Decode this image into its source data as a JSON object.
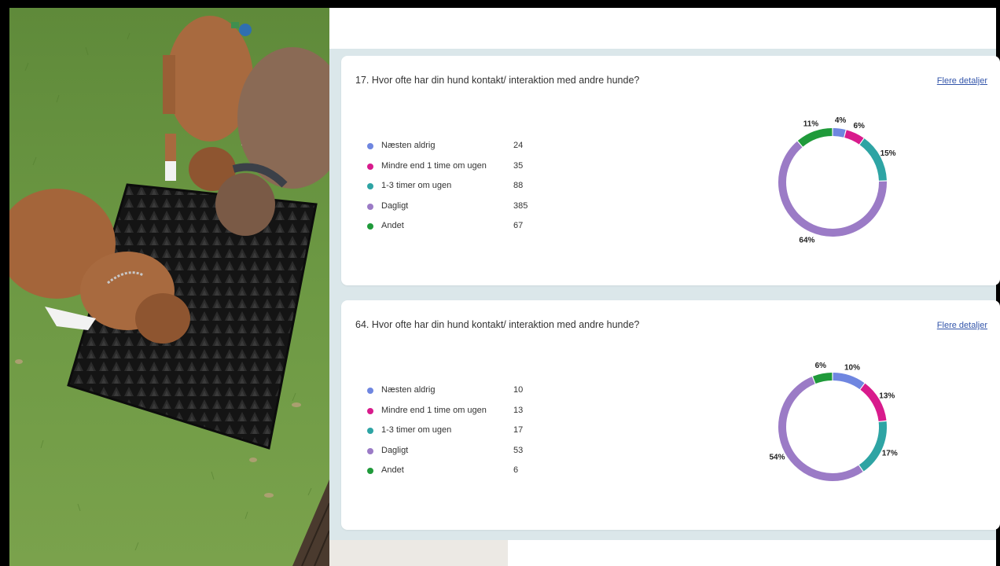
{
  "colors": {
    "naesten_aldrig": "#6f86e0",
    "mindre_end": "#d81b8c",
    "timer": "#2ea4a4",
    "dagligt": "#9b7bc6",
    "andet": "#1f9a3a"
  },
  "cards": [
    {
      "title": "17. Hvor ofte har din hund kontakt/ interaktion med andre hunde?",
      "details_link": "Flere detaljer",
      "legend": [
        {
          "label": "Næsten aldrig",
          "value": "24"
        },
        {
          "label": "Mindre end 1 time om ugen",
          "value": "35"
        },
        {
          "label": "1-3 timer om ugen",
          "value": "88"
        },
        {
          "label": "Dagligt",
          "value": "385"
        },
        {
          "label": "Andet",
          "value": "67"
        }
      ],
      "chart_data": {
        "type": "pie",
        "categories": [
          "Næsten aldrig",
          "Mindre end 1 time om ugen",
          "1-3 timer om ugen",
          "Dagligt",
          "Andet"
        ],
        "values": [
          24,
          35,
          88,
          385,
          67
        ],
        "percent_labels": [
          "4%",
          "6%",
          "15%",
          "64%",
          "11%"
        ]
      }
    },
    {
      "title": "64. Hvor ofte har din hund kontakt/ interaktion med andre hunde?",
      "details_link": "Flere detaljer",
      "legend": [
        {
          "label": "Næsten aldrig",
          "value": "10"
        },
        {
          "label": "Mindre end 1 time om ugen",
          "value": "13"
        },
        {
          "label": "1-3 timer om ugen",
          "value": "17"
        },
        {
          "label": "Dagligt",
          "value": "53"
        },
        {
          "label": "Andet",
          "value": "6"
        }
      ],
      "chart_data": {
        "type": "pie",
        "categories": [
          "Næsten aldrig",
          "Mindre end 1 time om ugen",
          "1-3 timer om ugen",
          "Dagligt",
          "Andet"
        ],
        "values": [
          10,
          13,
          17,
          53,
          6
        ],
        "percent_labels": [
          "10%",
          "13%",
          "17%",
          "54%",
          "6%"
        ]
      }
    }
  ]
}
